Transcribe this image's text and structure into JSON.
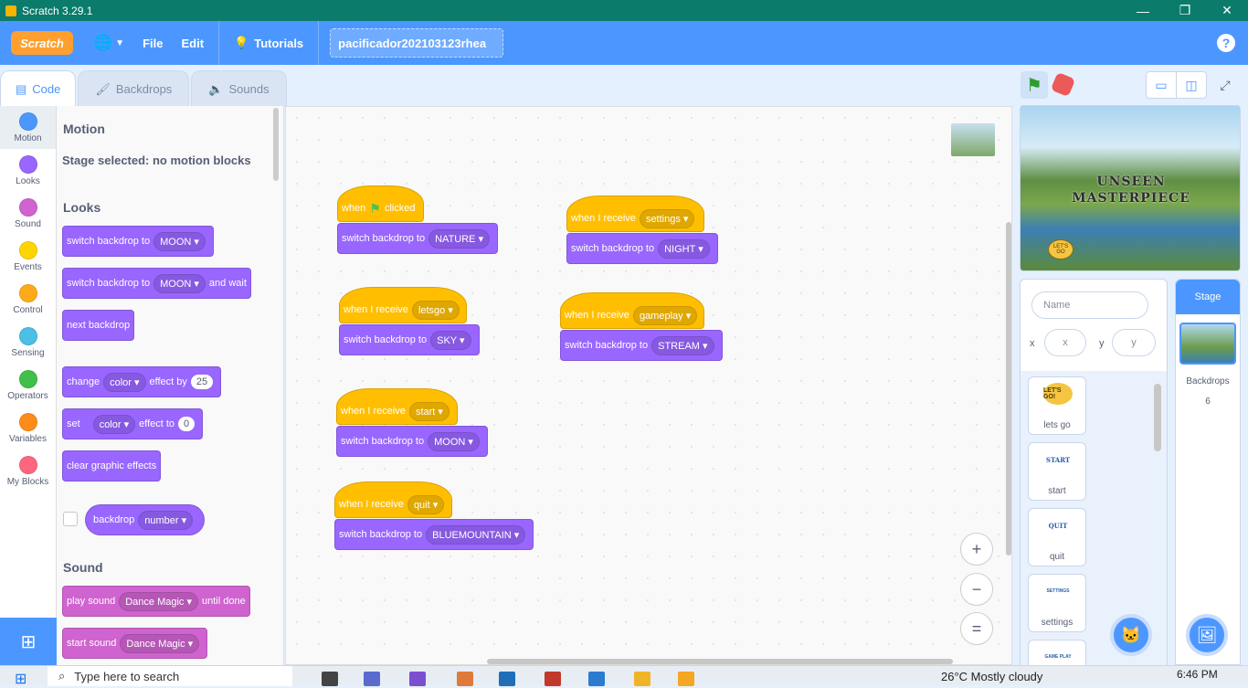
{
  "window": {
    "title": "Scratch 3.29.1",
    "min": "—",
    "restore": "❐",
    "close": "✕"
  },
  "menubar": {
    "logo": "Scratch",
    "file": "File",
    "edit": "Edit",
    "tutorials": "Tutorials",
    "project_title": "pacificador202103123rhea",
    "help": "?"
  },
  "tabs": [
    {
      "icon": "▤",
      "label": "Code"
    },
    {
      "icon": "🖌",
      "label": "Backdrops"
    },
    {
      "icon": "🔈",
      "label": "Sounds"
    }
  ],
  "categories": [
    {
      "label": "Motion",
      "color": "#4c97ff"
    },
    {
      "label": "Looks",
      "color": "#9966ff"
    },
    {
      "label": "Sound",
      "color": "#cf63cf"
    },
    {
      "label": "Events",
      "color": "#ffd500"
    },
    {
      "label": "Control",
      "color": "#ffab19"
    },
    {
      "label": "Sensing",
      "color": "#4cbfe6"
    },
    {
      "label": "Operators",
      "color": "#40bf4a"
    },
    {
      "label": "Variables",
      "color": "#ff8c1a"
    },
    {
      "label": "My Blocks",
      "color": "#ff6680"
    }
  ],
  "palette": {
    "motion_head": "Motion",
    "motion_note": "Stage selected: no motion blocks",
    "looks_head": "Looks",
    "switch_backdrop_to": "switch backdrop to",
    "moon": "MOON",
    "and_wait": "and wait",
    "next_backdrop": "next backdrop",
    "change": "change",
    "color": "color",
    "effect_by": "effect by",
    "effect_by_value": "25",
    "set": "set",
    "effect_to": "effect to",
    "effect_to_value": "0",
    "clear_graphic_effects": "clear graphic effects",
    "backdrop": "backdrop",
    "number": "number",
    "sound_head": "Sound",
    "play_sound": "play sound",
    "dance_magic": "Dance Magic",
    "until_done": "until done",
    "start_sound": "start sound"
  },
  "scripts": {
    "when": "when",
    "clicked": "clicked",
    "when_i_receive": "when I receive",
    "switch_backdrop_to": "switch backdrop to",
    "s1_backdrop": "NATURE",
    "s2_msg": "letsgo",
    "s2_backdrop": "SKY",
    "s3_msg": "start",
    "s3_backdrop": "MOON",
    "s4_msg": "quit",
    "s4_backdrop": "BLUEMOUNTAIN",
    "s5_msg": "settings",
    "s5_backdrop": "NIGHT",
    "s6_msg": "gameplay",
    "s6_backdrop": "STREAM"
  },
  "zoom": {
    "in": "+",
    "out": "−",
    "reset": "="
  },
  "stage": {
    "title_line1": "UNSEEN",
    "title_line2": "MASTERPIECE",
    "button": "LET'S GO"
  },
  "sprite_info": {
    "name_placeholder": "Name",
    "x_label": "x",
    "x_placeholder": "x",
    "y_label": "y",
    "y_placeholder": "y"
  },
  "sprites": [
    {
      "name": "lets go",
      "thumb": "LET'S GO!"
    },
    {
      "name": "start",
      "thumb": "START"
    },
    {
      "name": "quit",
      "thumb": "QUIT"
    },
    {
      "name": "settings",
      "thumb": "SETTINGS"
    },
    {
      "name": "",
      "thumb": "GAME PLAY"
    }
  ],
  "stage_target": {
    "label": "Stage",
    "backdrops_label": "Backdrops",
    "backdrops_count": "6"
  },
  "taskbar": {
    "search_placeholder": "Type here to search",
    "weather": "26°C  Mostly cloudy",
    "time": "6:46 PM"
  }
}
